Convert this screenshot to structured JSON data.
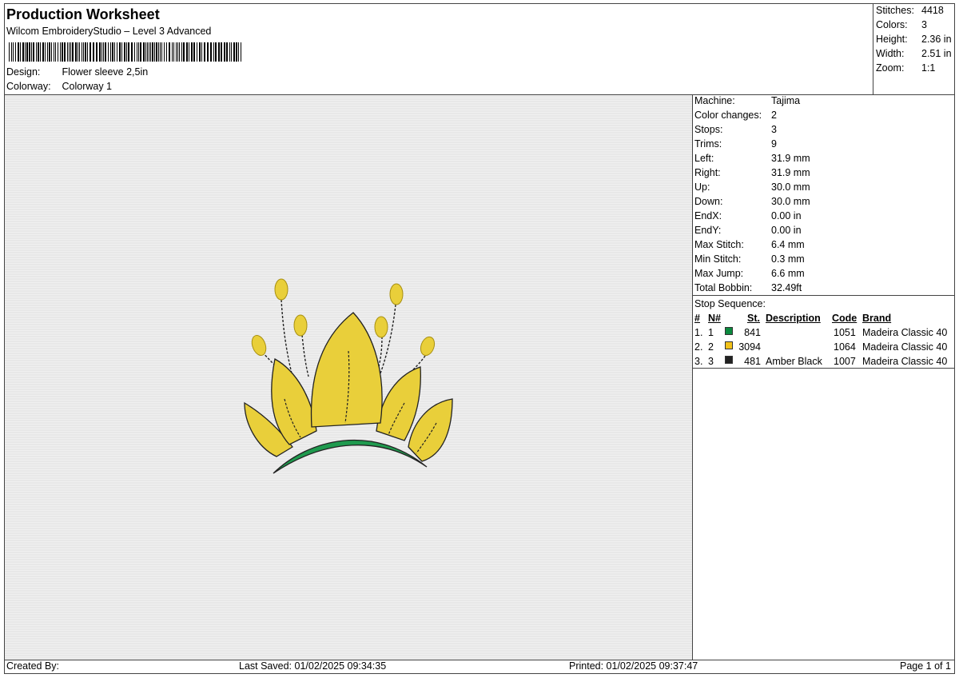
{
  "header": {
    "title": "Production Worksheet",
    "software": "Wilcom EmbroideryStudio – Level 3 Advanced",
    "design_label": "Design:",
    "design_value": "Flower sleeve 2,5in",
    "colorway_label": "Colorway:",
    "colorway_value": "Colorway 1"
  },
  "summary": [
    {
      "label": "Stitches:",
      "value": "4418"
    },
    {
      "label": "Colors:",
      "value": "3"
    },
    {
      "label": "Height:",
      "value": "2.36 in"
    },
    {
      "label": "Width:",
      "value": "2.51 in"
    },
    {
      "label": "Zoom:",
      "value": "1:1"
    }
  ],
  "properties": [
    {
      "label": "Machine:",
      "value": "Tajima"
    },
    {
      "label": "Color changes:",
      "value": "2"
    },
    {
      "label": "Stops:",
      "value": "3"
    },
    {
      "label": "Trims:",
      "value": "9"
    },
    {
      "label": "Left:",
      "value": "31.9 mm"
    },
    {
      "label": "Right:",
      "value": "31.9 mm"
    },
    {
      "label": "Up:",
      "value": "30.0 mm"
    },
    {
      "label": "Down:",
      "value": "30.0 mm"
    },
    {
      "label": "EndX:",
      "value": "0.00 in"
    },
    {
      "label": "EndY:",
      "value": "0.00 in"
    },
    {
      "label": "Max Stitch:",
      "value": "6.4 mm"
    },
    {
      "label": "Min Stitch:",
      "value": "0.3 mm"
    },
    {
      "label": "Max Jump:",
      "value": "6.6 mm"
    },
    {
      "label": "Total Bobbin:",
      "value": "32.49ft"
    }
  ],
  "stop_sequence": {
    "title": "Stop Sequence:",
    "headers": {
      "num": "#",
      "n": "N#",
      "st": "St.",
      "desc": "Description",
      "code": "Code",
      "brand": "Brand"
    },
    "rows": [
      {
        "num": "1.",
        "n": "1",
        "color": "#0b8a3e",
        "st": "841",
        "desc": "",
        "code": "1051",
        "brand": "Madeira Classic 40"
      },
      {
        "num": "2.",
        "n": "2",
        "color": "#f2c21a",
        "st": "3094",
        "desc": "",
        "code": "1064",
        "brand": "Madeira Classic 40"
      },
      {
        "num": "3.",
        "n": "3",
        "color": "#222222",
        "st": "481",
        "desc": "Amber Black",
        "code": "1007",
        "brand": "Madeira Classic 40"
      }
    ]
  },
  "footer": {
    "created_by": "Created By:",
    "last_saved": "Last Saved: 01/02/2025 09:34:35",
    "printed": "Printed: 01/02/2025 09:37:47",
    "page": "Page 1 of 1"
  },
  "colors": {
    "green": "#1f9a4e",
    "yellow": "#e9cf3a",
    "outline": "#222222",
    "canvas": "#e8e8e8"
  }
}
